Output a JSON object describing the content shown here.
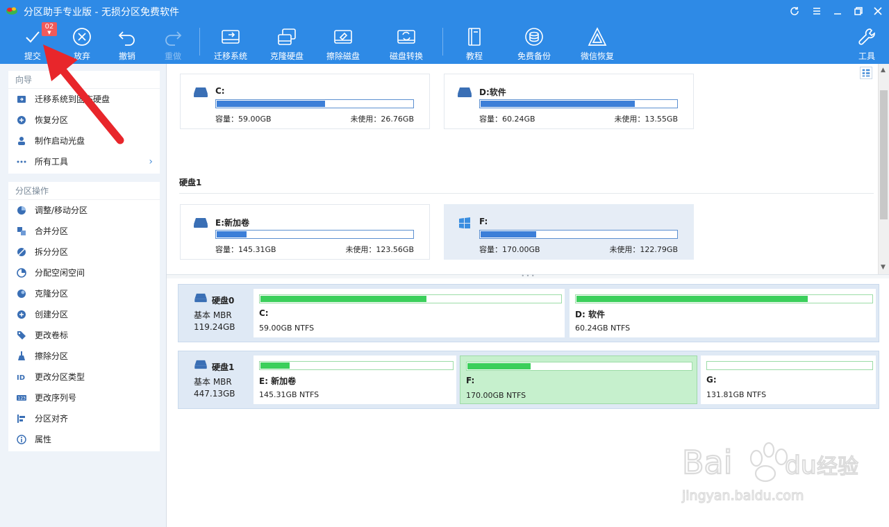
{
  "window": {
    "title": "分区助手专业版 - 无损分区免费软件"
  },
  "toolbar": {
    "pending_count": "02",
    "buttons": [
      {
        "label": "提交",
        "icon": "check-icon"
      },
      {
        "label": "放弃",
        "icon": "cancel-circle-icon"
      },
      {
        "label": "撤销",
        "icon": "undo-icon"
      },
      {
        "label": "重做",
        "icon": "redo-icon"
      },
      {
        "label": "迁移系统",
        "icon": "migrate-os-icon"
      },
      {
        "label": "克隆硬盘",
        "icon": "clone-disk-icon"
      },
      {
        "label": "擦除磁盘",
        "icon": "wipe-disk-icon"
      },
      {
        "label": "磁盘转换",
        "icon": "disk-convert-icon"
      },
      {
        "label": "教程",
        "icon": "book-icon"
      },
      {
        "label": "免费备份",
        "icon": "backup-icon"
      },
      {
        "label": "微信恢复",
        "icon": "wechat-recovery-icon"
      },
      {
        "label": "工具",
        "icon": "wrench-icon"
      }
    ]
  },
  "sidebar": {
    "wizard": {
      "heading": "向导",
      "items": [
        {
          "label": "迁移系统到固态硬盘"
        },
        {
          "label": "恢复分区"
        },
        {
          "label": "制作启动光盘"
        },
        {
          "label": "所有工具"
        }
      ]
    },
    "partition_ops": {
      "heading": "分区操作",
      "items": [
        {
          "label": "调整/移动分区"
        },
        {
          "label": "合并分区"
        },
        {
          "label": "拆分分区"
        },
        {
          "label": "分配空闲空间"
        },
        {
          "label": "克隆分区"
        },
        {
          "label": "创建分区"
        },
        {
          "label": "更改卷标"
        },
        {
          "label": "擦除分区"
        },
        {
          "label": "更改分区类型"
        },
        {
          "label": "更改序列号"
        },
        {
          "label": "分区对齐"
        },
        {
          "label": "属性"
        }
      ]
    }
  },
  "volume_view": {
    "disk1_heading": "硬盘1",
    "cards": [
      {
        "name": "C:",
        "capacity": "容量：59.00GB",
        "free": "未使用：26.76GB",
        "used_fraction": 0.55,
        "icon": "drive-icon"
      },
      {
        "name": "D:软件",
        "capacity": "容量：60.24GB",
        "free": "未使用：13.55GB",
        "used_fraction": 0.78,
        "icon": "drive-icon"
      },
      {
        "name": "E:新加卷",
        "capacity": "容量：145.31GB",
        "free": "未使用：123.56GB",
        "used_fraction": 0.15,
        "icon": "drive-icon"
      },
      {
        "name": "F:",
        "capacity": "容量：170.00GB",
        "free": "未使用：122.79GB",
        "used_fraction": 0.28,
        "icon": "windows-icon"
      }
    ]
  },
  "disk_map": {
    "disks": [
      {
        "name": "硬盘0",
        "type": "基本 MBR",
        "size": "119.24GB",
        "partitions": [
          {
            "name": "C:",
            "info": "59.00GB NTFS",
            "used_fraction": 0.55
          },
          {
            "name": "D: 软件",
            "info": "60.24GB NTFS",
            "used_fraction": 0.78
          }
        ]
      },
      {
        "name": "硬盘1",
        "type": "基本 MBR",
        "size": "447.13GB",
        "partitions": [
          {
            "name": "E: 新加卷",
            "info": "145.31GB NTFS",
            "used_fraction": 0.15
          },
          {
            "name": "F:",
            "info": "170.00GB NTFS",
            "used_fraction": 0.28
          },
          {
            "name": "G:",
            "info": "131.81GB NTFS",
            "used_fraction": 0.0
          }
        ]
      }
    ]
  },
  "watermark": {
    "text_main": "Bai",
    "text_after": "du",
    "text_cn": "经验",
    "url": "jingyan.baidu.com"
  },
  "colors": {
    "brand_blue": "#2e8ae6",
    "used_blue": "#3c7fd8",
    "used_green": "#3bcf5b",
    "arrow_red": "#e8262b"
  }
}
